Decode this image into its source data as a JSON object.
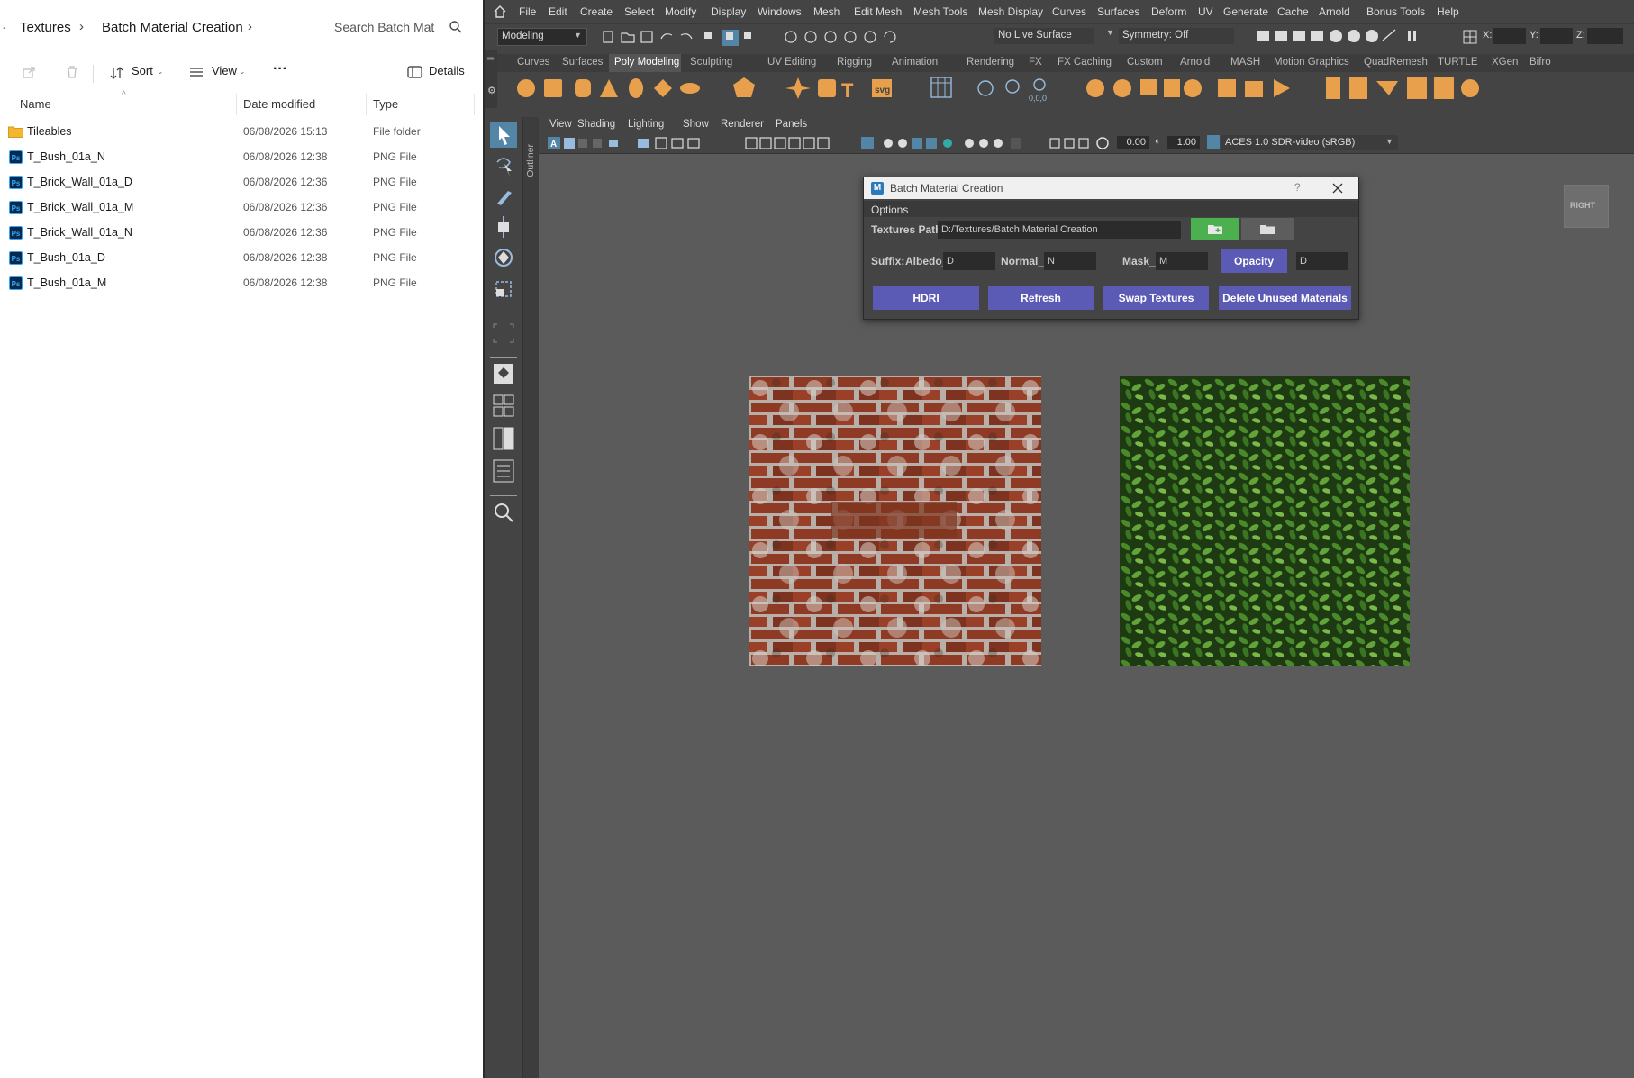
{
  "explorer": {
    "breadcrumb": [
      "Textures",
      "Batch Material Creation"
    ],
    "search_placeholder": "Search Batch Mat",
    "toolbar": {
      "sort_label": "Sort",
      "view_label": "View",
      "more_label": "···",
      "details_label": "Details"
    },
    "columns": [
      "Name",
      "Date modified",
      "Type"
    ],
    "files": [
      {
        "name": "Tileables",
        "date": "06/08/2026 15:13",
        "type": "File folder",
        "icon": "folder-icon"
      },
      {
        "name": "T_Bush_01a_N",
        "date": "06/08/2026 12:38",
        "type": "PNG File",
        "icon": "photoshop-file-icon"
      },
      {
        "name": "T_Brick_Wall_01a_D",
        "date": "06/08/2026 12:36",
        "type": "PNG File",
        "icon": "photoshop-file-icon"
      },
      {
        "name": "T_Brick_Wall_01a_M",
        "date": "06/08/2026 12:36",
        "type": "PNG File",
        "icon": "photoshop-file-icon"
      },
      {
        "name": "T_Brick_Wall_01a_N",
        "date": "06/08/2026 12:36",
        "type": "PNG File",
        "icon": "photoshop-file-icon"
      },
      {
        "name": "T_Bush_01a_D",
        "date": "06/08/2026 12:38",
        "type": "PNG File",
        "icon": "photoshop-file-icon"
      },
      {
        "name": "T_Bush_01a_M",
        "date": "06/08/2026 12:38",
        "type": "PNG File",
        "icon": "photoshop-file-icon"
      }
    ]
  },
  "maya": {
    "menu": [
      "File",
      "Edit",
      "Create",
      "Select",
      "Modify",
      "Display",
      "Windows",
      "Mesh",
      "Edit Mesh",
      "Mesh Tools",
      "Mesh Display",
      "Curves",
      "Surfaces",
      "Deform",
      "UV",
      "Generate",
      "Cache",
      "Arnold",
      "Bonus Tools",
      "Help"
    ],
    "statusline": {
      "mode": "Modeling",
      "live_surface": "No Live Surface",
      "symmetry": "Symmetry: Off",
      "x_label": "X:",
      "y_label": "Y:",
      "z_label": "Z:"
    },
    "shelf_tabs": [
      "Curves",
      "Surfaces",
      "Poly Modeling",
      "Sculpting",
      "UV Editing",
      "Rigging",
      "Animation",
      "Rendering",
      "FX",
      "FX Caching",
      "Custom",
      "Arnold",
      "MASH",
      "Motion Graphics",
      "QuadRemesh",
      "TURTLE",
      "XGen",
      "Bifro"
    ],
    "active_shelf": "Poly Modeling",
    "panel_menu": [
      "View",
      "Shading",
      "Lighting",
      "Show",
      "Renderer",
      "Panels"
    ],
    "panel_toolbar": {
      "exposure": "0.00",
      "gamma": "1.00",
      "color_space": "ACES 1.0 SDR-video (sRGB)"
    },
    "outliner_label": "Outliner",
    "view_cube_label": "RIGHT",
    "shelf_svg_label": "svg",
    "shelf_coords_label": "0,0,0"
  },
  "dialog": {
    "title": "Batch Material Creation",
    "help": "?",
    "options_label": "Options",
    "textures_path_label": "Textures Path:",
    "textures_path_value": "D:/Textures/Batch Material Creation",
    "suffix_label": "Suffix:",
    "albedo_label": "Albedo_",
    "albedo_value": "D",
    "normal_label": "Normal_",
    "normal_value": "N",
    "mask_label": "Mask_",
    "mask_value": "M",
    "opacity_label": "Opacity",
    "opacity_value": "D",
    "buttons": [
      "HDRI",
      "Refresh",
      "Swap Textures",
      "Delete Unused Materials"
    ]
  },
  "colors": {
    "accent_purple": "#5b5ab5",
    "accent_green": "#4caf50",
    "maya_bg": "#444444",
    "viewport_bg": "#5b5b5b",
    "shelf_orange": "#e8a04c"
  }
}
